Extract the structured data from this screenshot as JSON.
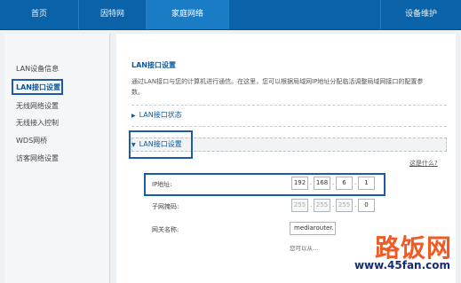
{
  "nav": {
    "tabs": [
      {
        "label": "首页"
      },
      {
        "label": "因特网"
      },
      {
        "label": "家庭网络"
      },
      {
        "label": ""
      },
      {
        "label": "设备维护"
      }
    ]
  },
  "sidebar": {
    "items": [
      {
        "label": "LAN设备信息"
      },
      {
        "label": "LAN接口设置"
      },
      {
        "label": "无线网络设置"
      },
      {
        "label": "无线接入控制"
      },
      {
        "label": "WDS网桥"
      },
      {
        "label": "访客网络设置"
      }
    ]
  },
  "main": {
    "title": "LAN接口设置",
    "description": "通过LAN接口与您的计算机进行通信。在这里，您可以根据局域网IP地址分配临活调整局域网接口的配置参数。",
    "section_status": "LAN接口状态",
    "section_settings": "LAN接口设置",
    "help_link": "这是什么?",
    "ip_label": "IP地址:",
    "ip": [
      "192",
      "168",
      "6",
      "1"
    ],
    "mask_label": "子网掩码:",
    "mask": [
      "255",
      "255",
      "255",
      "0"
    ],
    "gw_label": "网关名称:",
    "gw_value": "mediarouter.",
    "note": "您可以从…"
  },
  "watermark": {
    "text": "路饭网",
    "url": "www.45fan.com"
  },
  "colors": {
    "nav_bg": "#0a63a8",
    "accent": "#0b5aa0",
    "highlight_box": "#1f5aa8",
    "watermark": "#f05a24"
  }
}
